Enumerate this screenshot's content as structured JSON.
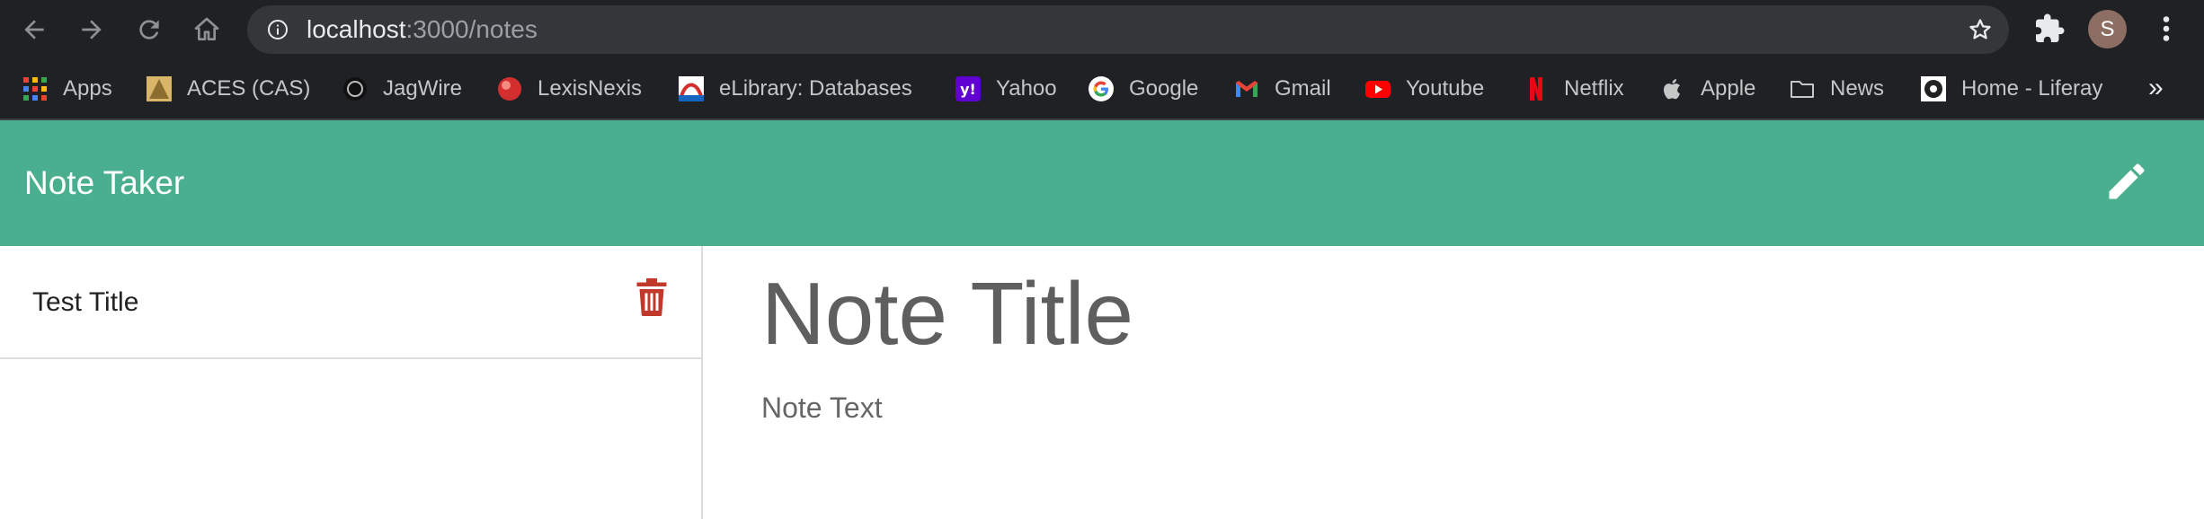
{
  "browser": {
    "url_host": "localhost",
    "url_path": ":3000/notes",
    "profile_initial": "S",
    "bookmarks": [
      {
        "label": "Apps",
        "icon": "apps-grid-icon"
      },
      {
        "label": "ACES (CAS)",
        "icon": "aces-icon"
      },
      {
        "label": "JagWire",
        "icon": "jagwire-icon"
      },
      {
        "label": "LexisNexis",
        "icon": "lexisnexis-icon"
      },
      {
        "label": "eLibrary: Databases",
        "icon": "elibrary-icon"
      },
      {
        "label": "Yahoo",
        "icon": "yahoo-icon"
      },
      {
        "label": "Google",
        "icon": "google-icon"
      },
      {
        "label": "Gmail",
        "icon": "gmail-icon"
      },
      {
        "label": "Youtube",
        "icon": "youtube-icon"
      },
      {
        "label": "Netflix",
        "icon": "netflix-icon"
      },
      {
        "label": "Apple",
        "icon": "apple-icon"
      },
      {
        "label": "News",
        "icon": "folder-icon"
      },
      {
        "label": "Home - Liferay",
        "icon": "liferay-icon"
      }
    ],
    "overflow_label": "»"
  },
  "app": {
    "title": "Note Taker",
    "accent_color": "#4aaf8f",
    "delete_color": "#c0392b",
    "notes": [
      {
        "title": "Test Title"
      }
    ],
    "editor": {
      "title_placeholder": "Note Title",
      "text_placeholder": "Note Text"
    }
  }
}
